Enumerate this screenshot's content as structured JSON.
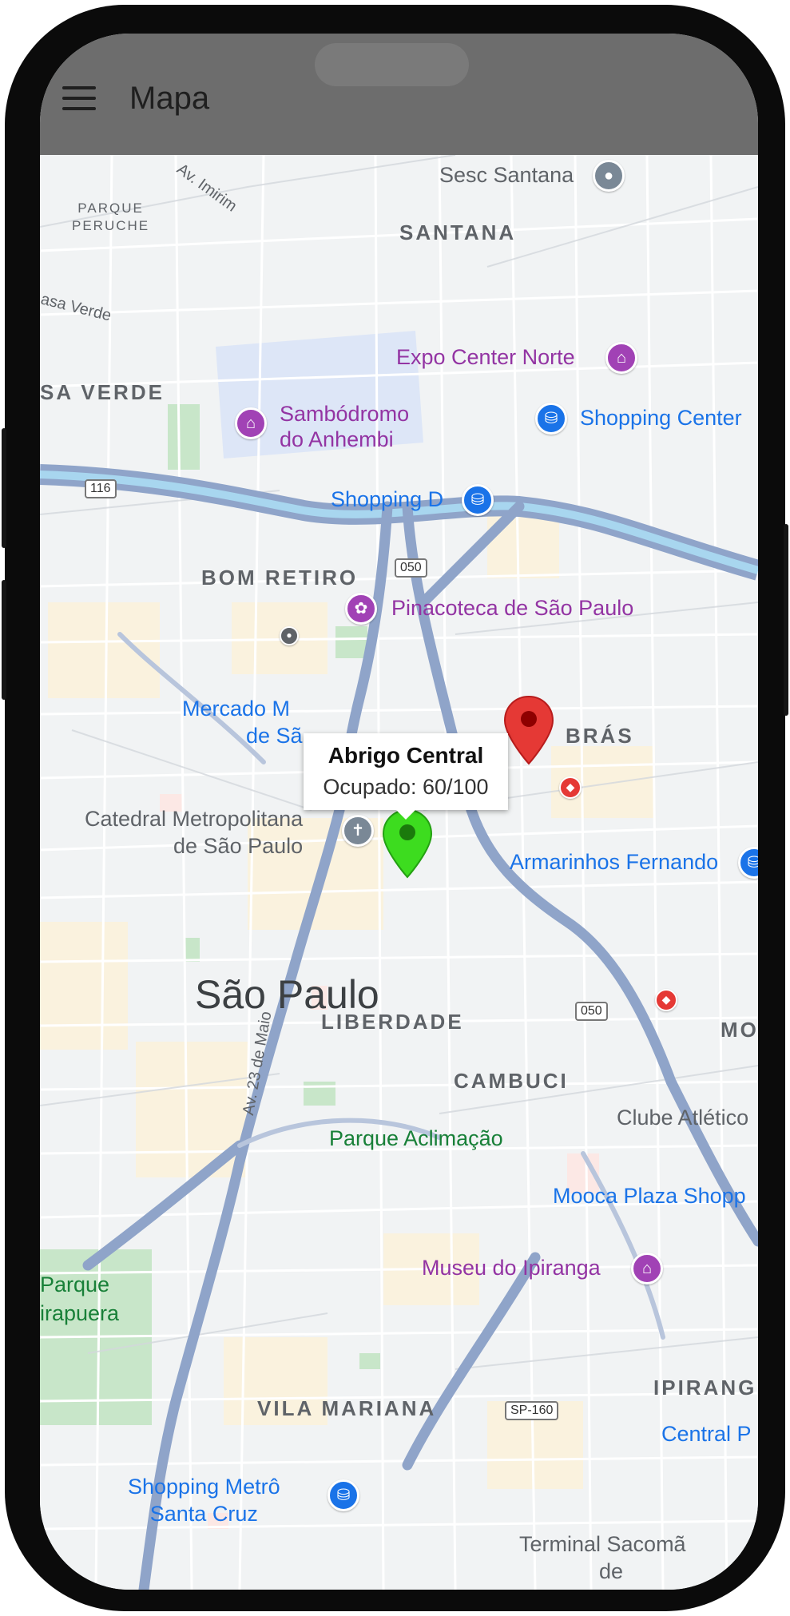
{
  "app_bar": {
    "title": "Mapa",
    "menu_icon": "menu-icon",
    "background": "#6d6d6d"
  },
  "map": {
    "city": "São Paulo",
    "districts": {
      "santana": "SANTANA",
      "casa_verde": "SA VERDE",
      "bom_retiro": "BOM RETIRO",
      "bras": "BRÁS",
      "liberdade": "LIBERDADE",
      "cambuci": "CAMBUCI",
      "mooca": "MO",
      "ipiranga": "IPIRANG",
      "vila_mariana": "VILA MARIANA",
      "parque_peruche_1": "PARQUE",
      "parque_peruche_2": "PERUCHE"
    },
    "streets": {
      "imirim": "Av. Imirim",
      "casa_verde": "asa Verde",
      "av_23_de_maio": "Av. 23 de Maio"
    },
    "highway_shields": {
      "br116": "116",
      "br050_north": "050",
      "br050_south": "050",
      "sp160": "SP-160"
    },
    "pois": {
      "sesc_santana": "Sesc Santana",
      "expo_center_norte": "Expo Center Norte",
      "sambodromo_1": "Sambódromo",
      "sambodromo_2": "do Anhembi",
      "shopping_center_norte": "Shopping Center",
      "shopping_d": "Shopping D",
      "pinacoteca": "Pinacoteca de São Paulo",
      "mercado_1": "Mercado M",
      "mercado_2": "de Sã",
      "catedral_1": "Catedral Metropolitana",
      "catedral_2": "de São Paulo",
      "armarinhos": "Armarinhos Fernando",
      "clube_atletico": "Clube Atlético",
      "parque_aclimacao": "Parque Aclimação",
      "mooca_plaza": "Mooca Plaza Shopp",
      "museu_ipiranga": "Museu do Ipiranga",
      "parque_ibirapuera_1": "Parque",
      "parque_ibirapuera_2": "irapuera",
      "central_plaza": "Central P",
      "shopping_metro_1": "Shopping Metrô",
      "shopping_metro_2": "Santa Cruz",
      "terminal_1": "Terminal Sacomã",
      "terminal_2": "de"
    },
    "markers": {
      "red": {
        "color": "#e53935",
        "icon": "map-marker-icon"
      },
      "green": {
        "color": "#3ddc1f",
        "icon": "map-marker-icon"
      }
    },
    "info_window": {
      "title": "Abrigo Central",
      "occupancy_text": "Ocupado: 60/100"
    }
  },
  "colors": {
    "map_background": "#f1f3f4",
    "highway": "#8fa4c9",
    "water": "#a8d6ef",
    "park": "#c8e6c9",
    "poi_purple": "#9334a3",
    "poi_blue": "#1a73e8"
  }
}
